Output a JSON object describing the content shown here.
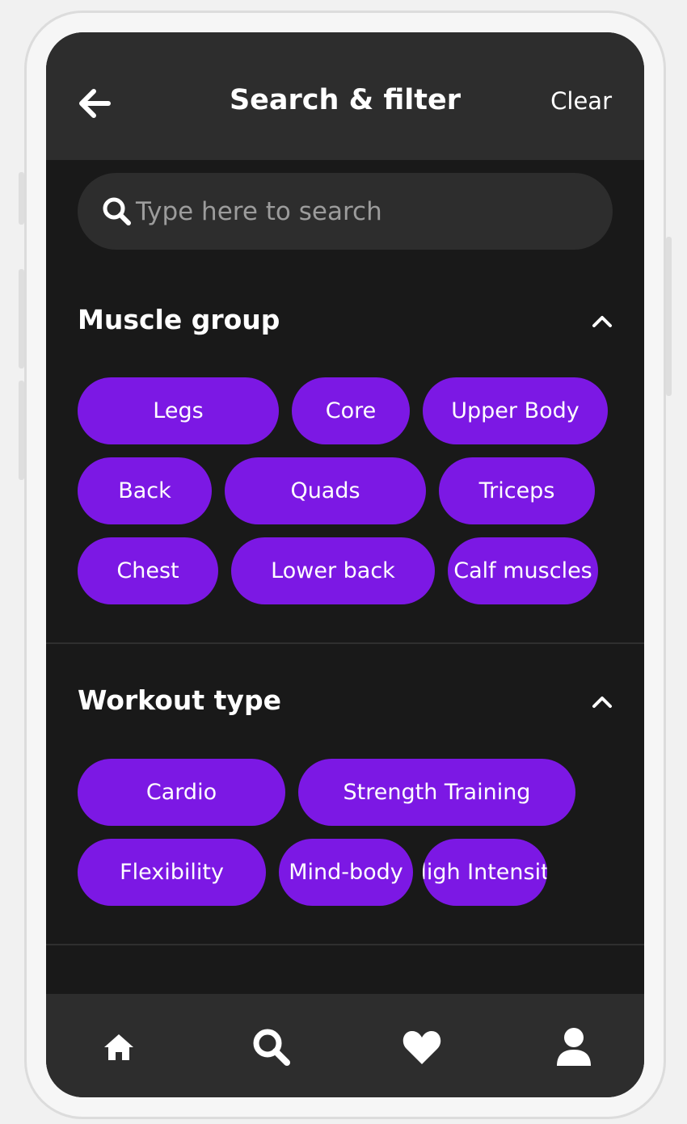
{
  "header": {
    "title": "Search & filter",
    "clear_label": "Clear"
  },
  "search": {
    "placeholder": "Type here to search"
  },
  "sections": {
    "muscle_group": {
      "title": "Muscle group",
      "chips": [
        "Legs",
        "Core",
        "Upper Body",
        "Back",
        "Quads",
        "Triceps",
        "Chest",
        "Lower back",
        "Calf muscles"
      ]
    },
    "workout_type": {
      "title": "Workout type",
      "chips": [
        "Cardio",
        "Strength Training",
        "Flexibility",
        "Mind-body",
        "ligh Intensit"
      ]
    }
  },
  "nav": {
    "items": [
      "home-icon",
      "search-icon",
      "heart-icon",
      "user-icon"
    ]
  },
  "colors": {
    "accent": "#7c18e4",
    "background": "#191919",
    "bar": "#2d2d2d"
  }
}
